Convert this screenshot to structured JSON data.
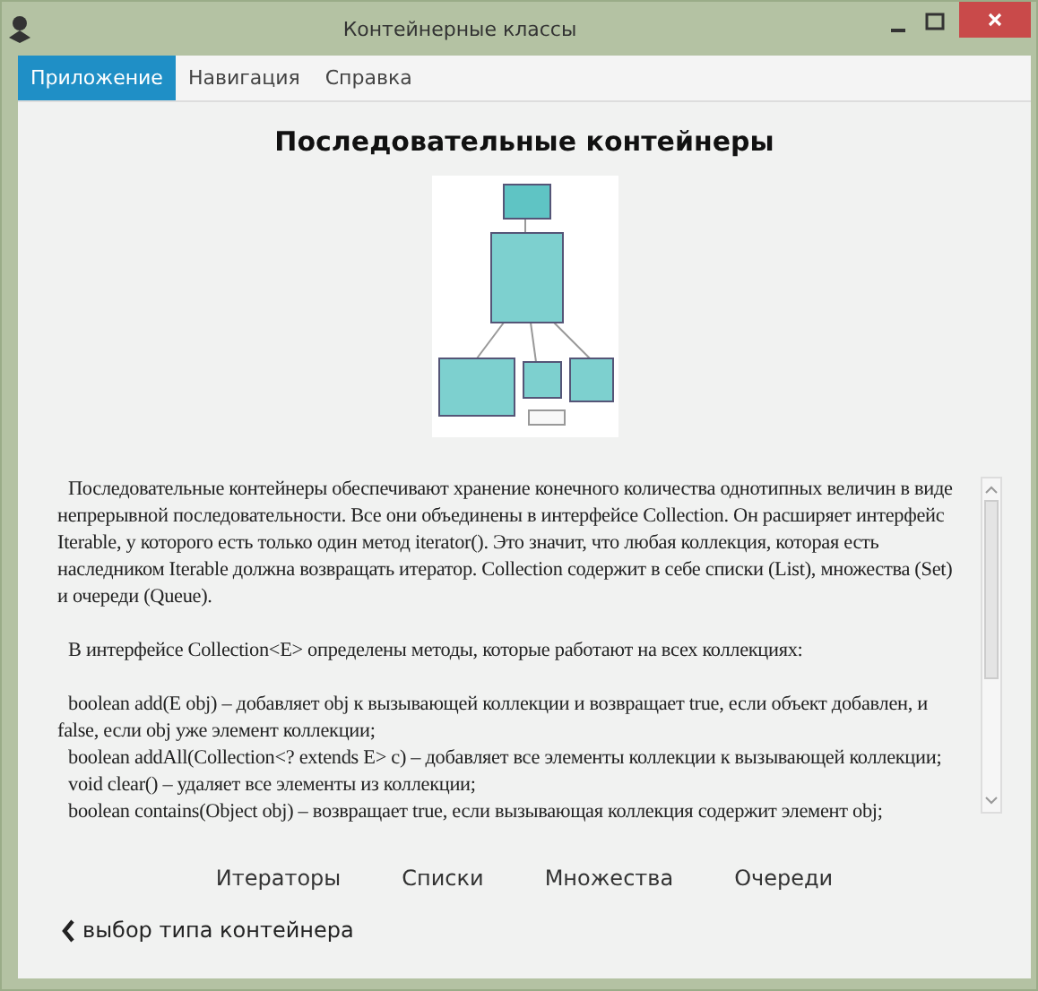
{
  "window": {
    "title": "Контейнерные классы"
  },
  "menu": [
    {
      "label": "Приложение",
      "selected": true
    },
    {
      "label": "Навигация",
      "selected": false
    },
    {
      "label": "Справка",
      "selected": false
    }
  ],
  "heading": "Последовательные контейнеры",
  "paragraphs": [
    "Последовательные контейнеры обеспечивают хранение конечного количества однотипных величин в виде непрерывной последовательности. Все они объединены в интерфейсе Collection. Он расширяет интерфейс Iterable, у которого есть только один метод iterator(). Это значит, что любая коллекция, которая есть наследником Iterable должна возвращать итератор. Collection содержит в себе списки (List), множества (Set) и очереди (Queue).",
    "В интерфейсе Collection<E> определены методы, которые работают на всех коллекциях:"
  ],
  "methods": [
    "boolean add(E obj) – добавляет obj к вызывающей коллекции и возвращает true, если объект добавлен, и false, если obj уже элемент коллекции;",
    "boolean addAll(Collection<?  extends E>  c) –  добавляет  все элементы коллекции к вызывающей коллекции;",
    "void clear() – удаляет все элементы из коллекции;",
    "boolean contains(Object obj) – возвращает true, если вызывающая коллекция содержит элемент  obj;"
  ],
  "links": [
    "Итераторы",
    "Списки",
    "Множества",
    "Очереди"
  ],
  "back": "выбор типа контейнера"
}
